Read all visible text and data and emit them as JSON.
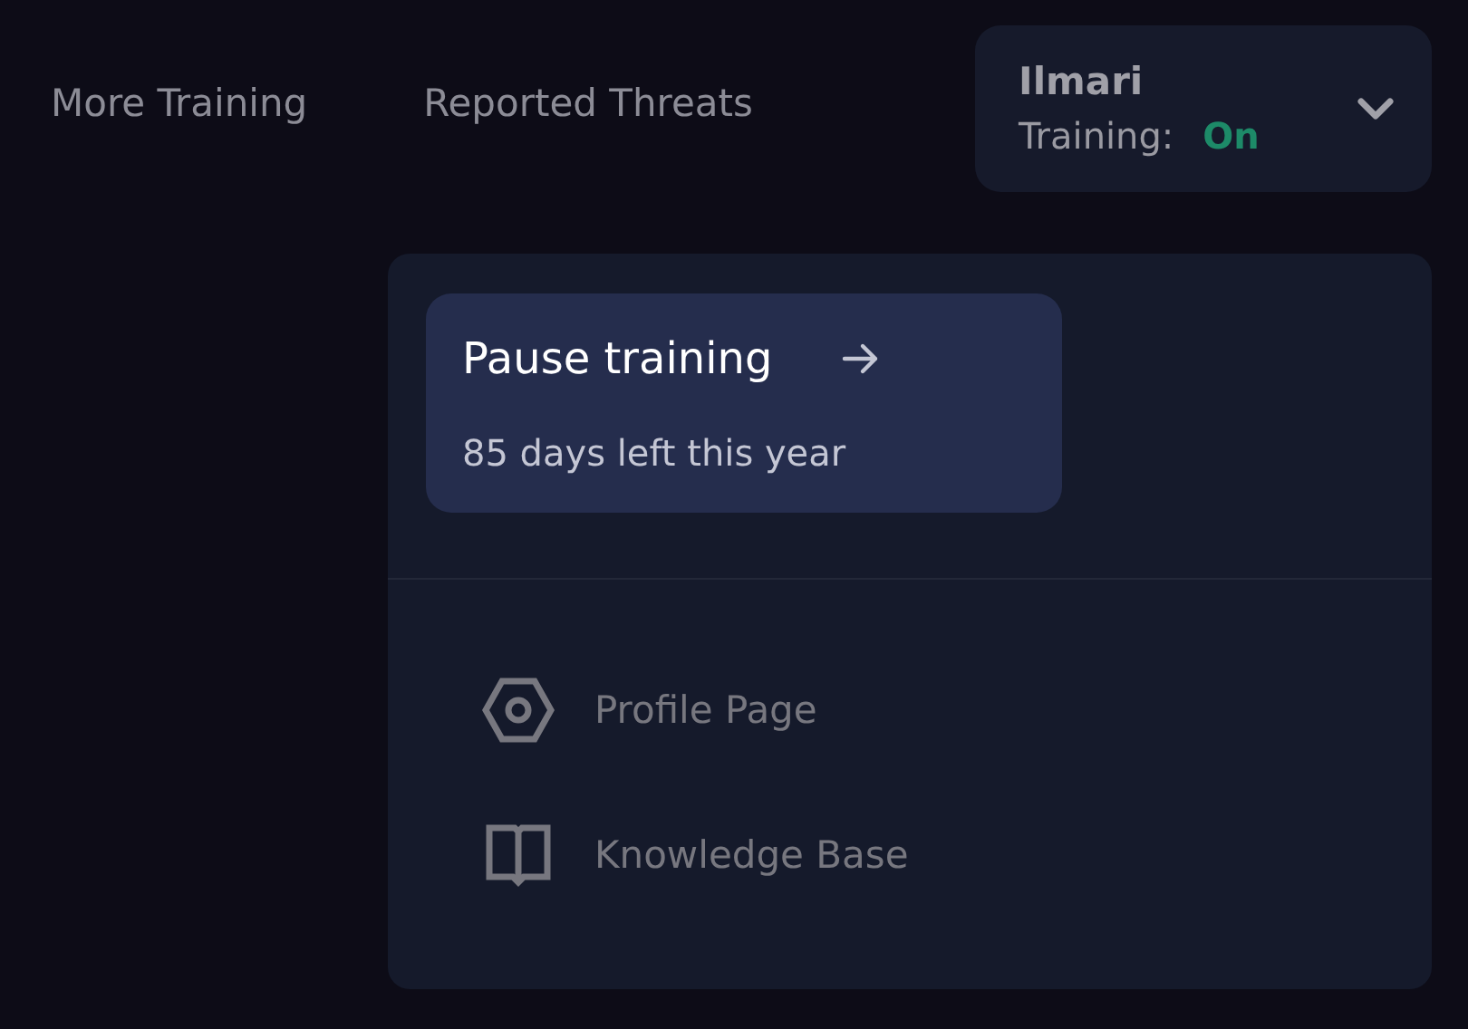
{
  "nav": [
    "More Training",
    "Reported Threats"
  ],
  "user": {
    "name": "Ilmari",
    "training_label": "Training:",
    "training_status": "On",
    "training_on": true,
    "expanded": true
  },
  "dropdown": {
    "pause": {
      "title": "Pause training",
      "subtitle": "85 days left this year"
    },
    "items": [
      {
        "kind": "profile",
        "label": "Profile Page"
      },
      {
        "kind": "knowledge",
        "label": "Knowledge Base"
      }
    ]
  }
}
